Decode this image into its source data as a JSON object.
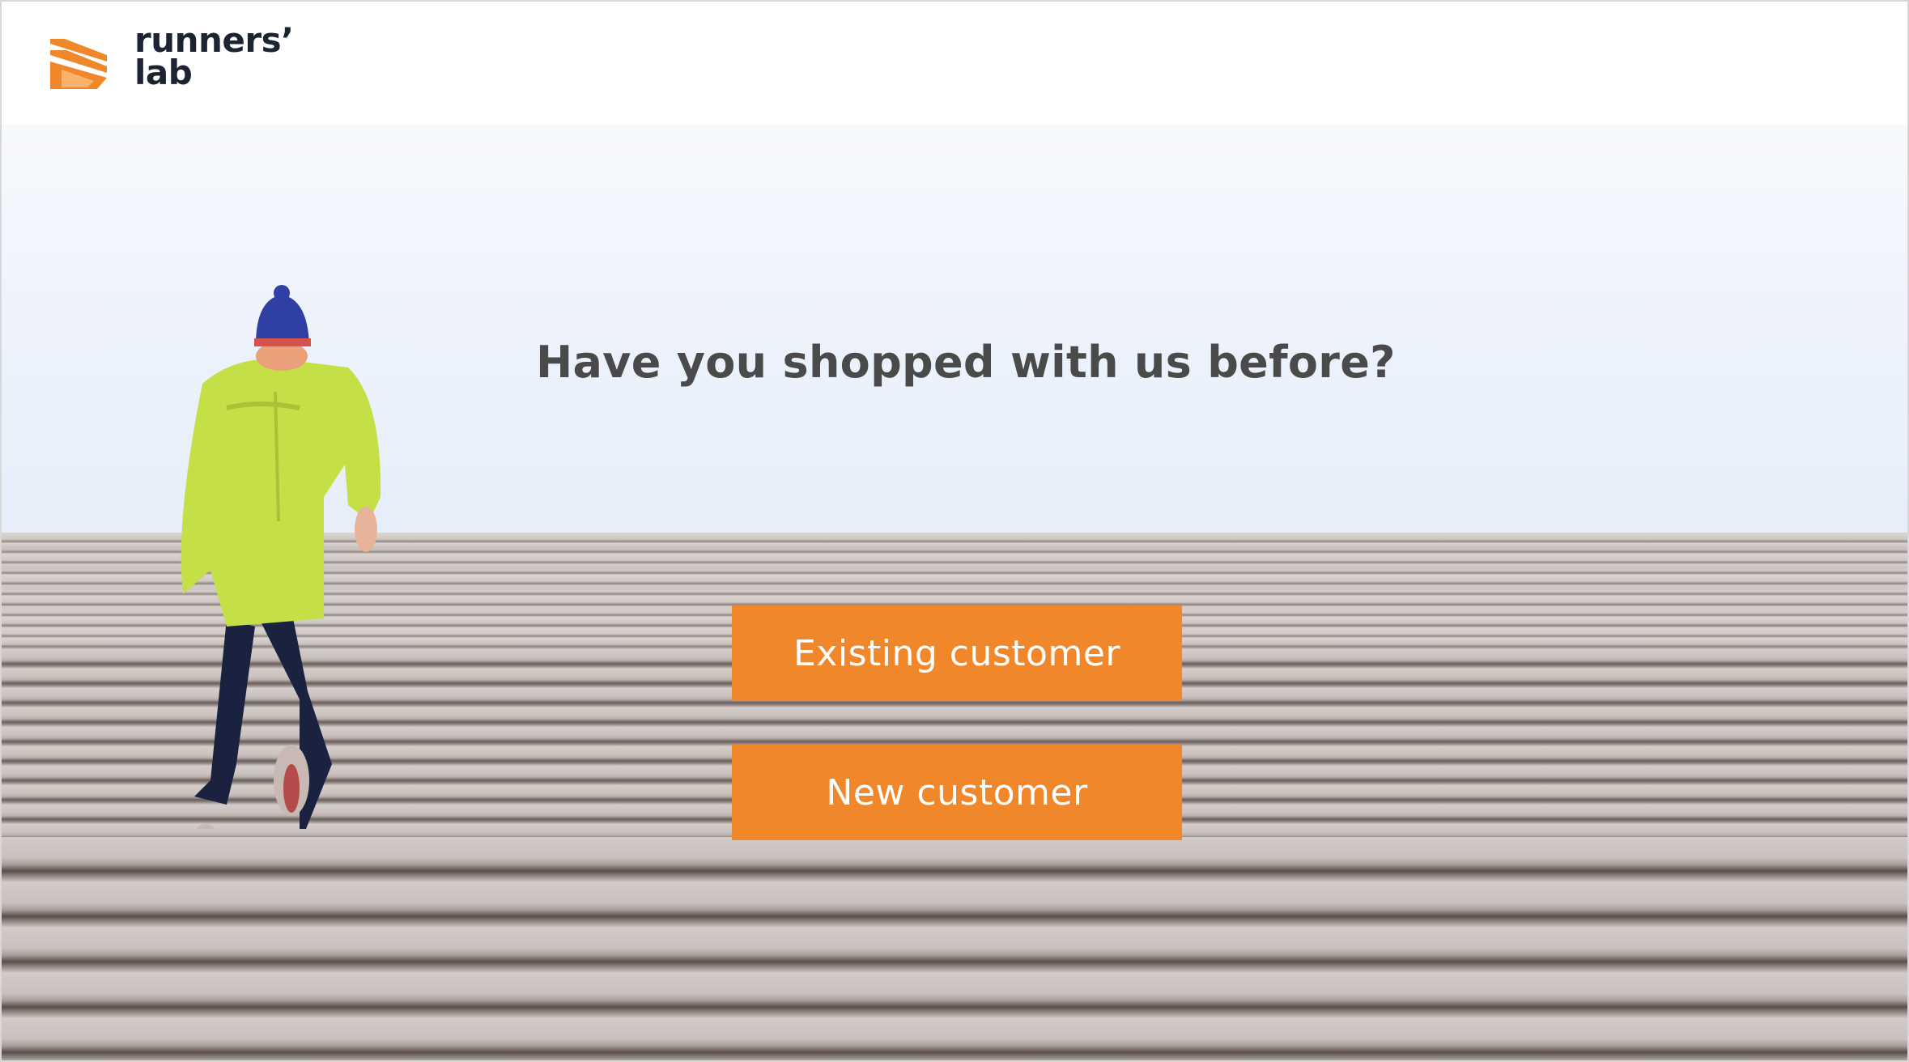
{
  "brand": {
    "name_line1": "runners’",
    "name_line2": "lab",
    "logo_icon": "chevron-stripes-icon",
    "accent_color": "#f0872a",
    "text_color": "#1c2433"
  },
  "main": {
    "question": "Have you shopped with us before?",
    "buttons": {
      "existing_label": "Existing customer",
      "new_label": "New customer"
    }
  },
  "background": {
    "image": "runner-climbing-stairs"
  }
}
